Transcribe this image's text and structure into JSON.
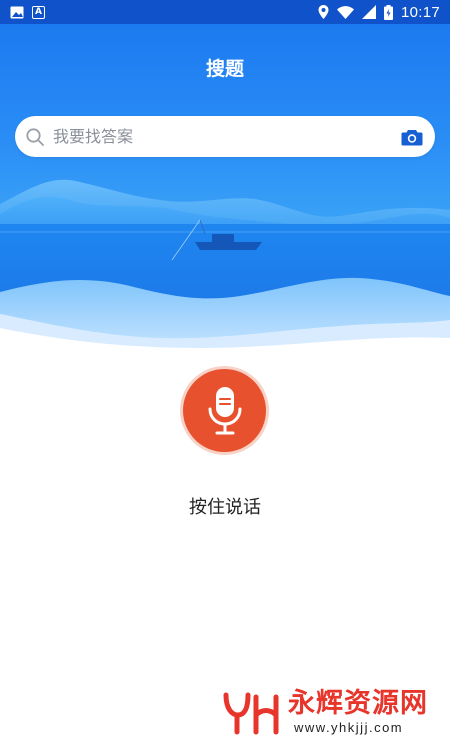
{
  "status_bar": {
    "left_icons": [
      "image-icon",
      "a-box-icon"
    ],
    "a_box_text": "A",
    "right_icons": [
      "location-icon",
      "wifi-icon",
      "signal-icon",
      "battery-icon"
    ],
    "time": "10:17"
  },
  "header": {
    "title": "搜题"
  },
  "search": {
    "placeholder": "我要找答案",
    "left_icon": "search-icon",
    "right_icon": "camera-icon"
  },
  "voice": {
    "icon": "microphone-icon",
    "label": "按住说话"
  },
  "watermark": {
    "logo_letters": "YH",
    "name": "永辉资源网",
    "url": "www.yhkjjj.com"
  },
  "colors": {
    "status_bar": "#0f52c9",
    "hero_blue": "#2a8df5",
    "mic_red": "#e8512e",
    "watermark_red": "#e8352b"
  }
}
